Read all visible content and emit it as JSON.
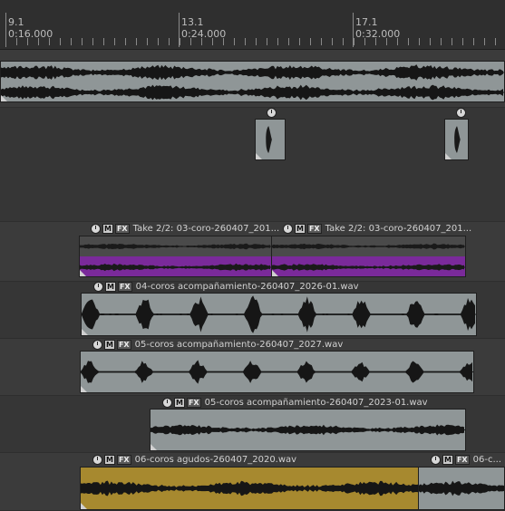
{
  "ruler": {
    "markers": [
      {
        "bar": "9.1",
        "time": "0:16.000"
      },
      {
        "bar": "13.1",
        "time": "0:24.000"
      },
      {
        "bar": "17.1",
        "time": "0:32.000"
      }
    ]
  },
  "items": {
    "master_track": {
      "label": ""
    },
    "small_item_1": {
      "label": ""
    },
    "small_item_2": {
      "label": ""
    },
    "take_a": {
      "title": "Take 2/2: 03-coro-260407_201..."
    },
    "take_b": {
      "title": "Take 2/2: 03-coro-260407_201..."
    },
    "coros_acomp_2026": {
      "title": "04-coros acompañamiento-260407_2026-01.wav"
    },
    "coros_acomp_2027": {
      "title": "05-coros acompañamiento-260407_2027.wav"
    },
    "coros_acomp_2023": {
      "title": "05-coros acompañamiento-260407_2023-01.wav"
    },
    "coros_agudos_2020": {
      "title": "06-coros agudos-260407_2020.wav"
    },
    "coros_agudos_next": {
      "title": "06-c..."
    }
  },
  "buttons": {
    "mute": "M",
    "fx": "FX"
  },
  "colors": {
    "item_gray": "#8f9697",
    "item_purple": "#7a2a9a",
    "item_gold": "#a7892f",
    "background": "#3a3a3a",
    "ruler_bg": "#2f2f2f"
  }
}
